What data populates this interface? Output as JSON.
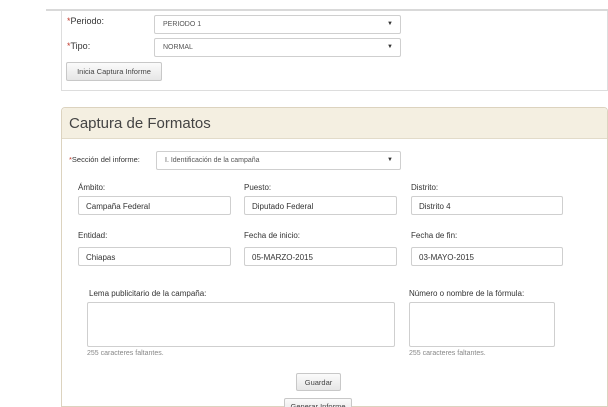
{
  "top": {
    "periodo_label": "Periodo:",
    "periodo_value": "PERIODO 1",
    "tipo_label": "Tipo:",
    "tipo_value": "NORMAL",
    "start_button": "Inicia Captura Informe"
  },
  "captura": {
    "title": "Captura de Formatos",
    "seccion_label": "Sección del informe:",
    "seccion_value": "I. Identificación de la campaña",
    "ambito_label": "Ámbito:",
    "ambito_value": "Campaña Federal",
    "puesto_label": "Puesto:",
    "puesto_value": "Diputado Federal",
    "distrito_label": "Distrito:",
    "distrito_value": "Distrito 4",
    "entidad_label": "Entidad:",
    "entidad_value": "Chiapas",
    "fecha_inicio_label": "Fecha de inicio:",
    "fecha_inicio_value": "05-MARZO-2015",
    "fecha_fin_label": "Fecha de fin:",
    "fecha_fin_value": "03-MAYO-2015",
    "lema_label": "Lema publicitario de la campaña:",
    "formula_label": "Número o nombre de la fórmula:",
    "lema_counter": "255 caracteres faltantes.",
    "formula_counter": "255 caracteres faltantes.",
    "save_button": "Guardar",
    "generate_button": "Generar Informe"
  }
}
